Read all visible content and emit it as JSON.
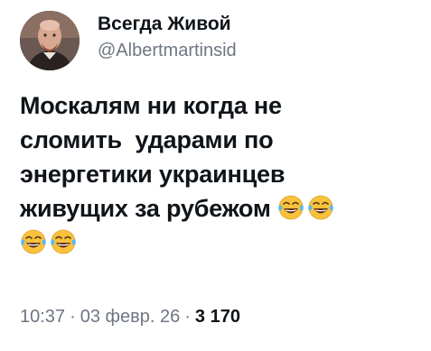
{
  "author": {
    "display_name": "Всегда Живой",
    "handle": "@Albertmartinsid",
    "avatar_icon": "portrait-avatar"
  },
  "post": {
    "lines": [
      "Москалям ни когда не",
      "сломить  ударами по",
      "энергетики украинцев",
      "живущих за рубежом"
    ],
    "emoji_name": "face-with-tears-of-joy",
    "emoji_count_line4": 2,
    "emoji_count_line5": 2
  },
  "meta": {
    "time": "10:37",
    "separator": "·",
    "date": "03 февр. 26",
    "views": "3 170"
  },
  "colors": {
    "text": "#0f1419",
    "secondary": "#6e7681",
    "emoji_face": "#f9c23c",
    "tears": "#5bb8ec"
  }
}
